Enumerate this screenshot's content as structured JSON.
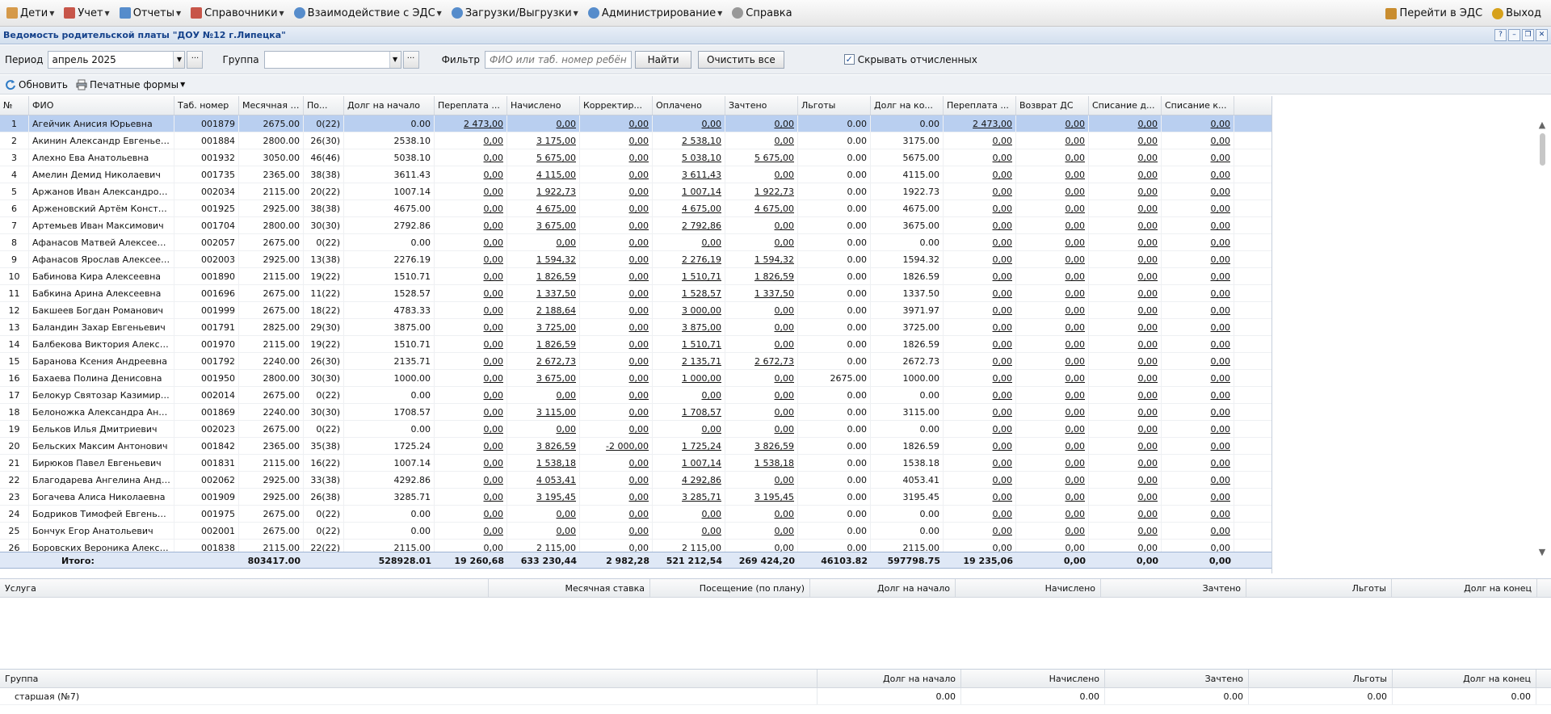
{
  "menu": {
    "items": [
      {
        "label": "Дети",
        "icon": "children-icon",
        "color": "#d08a2b"
      },
      {
        "label": "Учет",
        "icon": "accounting-icon",
        "color": "#c0392b"
      },
      {
        "label": "Отчеты",
        "icon": "reports-icon",
        "color": "#3b7ac4"
      },
      {
        "label": "Справочники",
        "icon": "directory-icon",
        "color": "#c0392b"
      },
      {
        "label": "Взаимодействие с ЭДС",
        "icon": "gears-icon",
        "color": "#3b7ac4"
      },
      {
        "label": "Загрузки/Выгрузки",
        "icon": "gears-icon",
        "color": "#3b7ac4"
      },
      {
        "label": "Администрирование",
        "icon": "gears-icon",
        "color": "#3b7ac4"
      },
      {
        "label": "Справка",
        "icon": "help-icon",
        "color": "#888888"
      }
    ],
    "go_eds": "Перейти в ЭДС",
    "exit": "Выход"
  },
  "window": {
    "title": "Ведомость родительской платы \"ДОУ №12 г.Липецка\"",
    "btn_help": "?",
    "btn_min": "–",
    "btn_max": "❐",
    "btn_close": "✕"
  },
  "filter": {
    "period_label": "Период",
    "period_value": "апрель 2025",
    "group_label": "Группа",
    "group_value": "",
    "filter_label": "Фильтр",
    "filter_placeholder": "ФИО или таб. номер ребёнка",
    "find": "Найти",
    "clear": "Очистить все",
    "hide_expelled": "Скрывать отчисленных",
    "hide_expelled_checked": true,
    "dots": "···"
  },
  "toolbar": {
    "refresh": "Обновить",
    "print": "Печатные формы"
  },
  "grid": {
    "columns": [
      "№",
      "ФИО",
      "Таб. номер",
      "Месячная ста...",
      "По...",
      "Долг на начало",
      "Переплата ...",
      "Начислено",
      "Корректир...",
      "Оплачено",
      "Зачтено",
      "Льготы",
      "Долг на ко...",
      "Переплата ...",
      "Возврат ДС",
      "Списание д...",
      "Списание к..."
    ],
    "rows": [
      [
        "1",
        "Агейчик Анисия Юрьевна",
        "001879",
        "2675.00",
        "0(22)",
        "0.00",
        "2 473,00",
        "0,00",
        "0,00",
        "0,00",
        "0,00",
        "0.00",
        "0.00",
        "2 473,00",
        "0,00",
        "0,00",
        "0,00"
      ],
      [
        "2",
        "Акинин Александр Евгеньевич",
        "001884",
        "2800.00",
        "26(30)",
        "2538.10",
        "0,00",
        "3 175,00",
        "0,00",
        "2 538,10",
        "0,00",
        "0.00",
        "3175.00",
        "0,00",
        "0,00",
        "0,00",
        "0,00"
      ],
      [
        "3",
        "Алехно Ева Анатольевна",
        "001932",
        "3050.00",
        "46(46)",
        "5038.10",
        "0,00",
        "5 675,00",
        "0,00",
        "5 038,10",
        "5 675,00",
        "0.00",
        "5675.00",
        "0,00",
        "0,00",
        "0,00",
        "0,00"
      ],
      [
        "4",
        "Амелин Демид Николаевич",
        "001735",
        "2365.00",
        "38(38)",
        "3611.43",
        "0,00",
        "4 115,00",
        "0,00",
        "3 611,43",
        "0,00",
        "0.00",
        "4115.00",
        "0,00",
        "0,00",
        "0,00",
        "0,00"
      ],
      [
        "5",
        "Аржанов Иван Александрович",
        "002034",
        "2115.00",
        "20(22)",
        "1007.14",
        "0,00",
        "1 922,73",
        "0,00",
        "1 007,14",
        "1 922,73",
        "0.00",
        "1922.73",
        "0,00",
        "0,00",
        "0,00",
        "0,00"
      ],
      [
        "6",
        "Арженовский Артём Константи...",
        "001925",
        "2925.00",
        "38(38)",
        "4675.00",
        "0,00",
        "4 675,00",
        "0,00",
        "4 675,00",
        "4 675,00",
        "0.00",
        "4675.00",
        "0,00",
        "0,00",
        "0,00",
        "0,00"
      ],
      [
        "7",
        "Артемьев Иван Максимович",
        "001704",
        "2800.00",
        "30(30)",
        "2792.86",
        "0,00",
        "3 675,00",
        "0,00",
        "2 792,86",
        "0,00",
        "0.00",
        "3675.00",
        "0,00",
        "0,00",
        "0,00",
        "0,00"
      ],
      [
        "8",
        "Афанасов Матвей Алексеевич",
        "002057",
        "2675.00",
        "0(22)",
        "0.00",
        "0,00",
        "0,00",
        "0,00",
        "0,00",
        "0,00",
        "0.00",
        "0.00",
        "0,00",
        "0,00",
        "0,00",
        "0,00"
      ],
      [
        "9",
        "Афанасов Ярослав Алексеевич",
        "002003",
        "2925.00",
        "13(38)",
        "2276.19",
        "0,00",
        "1 594,32",
        "0,00",
        "2 276,19",
        "1 594,32",
        "0.00",
        "1594.32",
        "0,00",
        "0,00",
        "0,00",
        "0,00"
      ],
      [
        "10",
        "Бабинова Кира Алексеевна",
        "001890",
        "2115.00",
        "19(22)",
        "1510.71",
        "0,00",
        "1 826,59",
        "0,00",
        "1 510,71",
        "1 826,59",
        "0.00",
        "1826.59",
        "0,00",
        "0,00",
        "0,00",
        "0,00"
      ],
      [
        "11",
        "Бабкина Арина Алексеевна",
        "001696",
        "2675.00",
        "11(22)",
        "1528.57",
        "0,00",
        "1 337,50",
        "0,00",
        "1 528,57",
        "1 337,50",
        "0.00",
        "1337.50",
        "0,00",
        "0,00",
        "0,00",
        "0,00"
      ],
      [
        "12",
        "Бакшеев Богдан Романович",
        "001999",
        "2675.00",
        "18(22)",
        "4783.33",
        "0,00",
        "2 188,64",
        "0,00",
        "3 000,00",
        "0,00",
        "0.00",
        "3971.97",
        "0,00",
        "0,00",
        "0,00",
        "0,00"
      ],
      [
        "13",
        "Баландин Захар Евгеньевич",
        "001791",
        "2825.00",
        "29(30)",
        "3875.00",
        "0,00",
        "3 725,00",
        "0,00",
        "3 875,00",
        "0,00",
        "0.00",
        "3725.00",
        "0,00",
        "0,00",
        "0,00",
        "0,00"
      ],
      [
        "14",
        "Балбекова Виктория Алексеевна",
        "001970",
        "2115.00",
        "19(22)",
        "1510.71",
        "0,00",
        "1 826,59",
        "0,00",
        "1 510,71",
        "0,00",
        "0.00",
        "1826.59",
        "0,00",
        "0,00",
        "0,00",
        "0,00"
      ],
      [
        "15",
        "Баранова Ксения Андреевна",
        "001792",
        "2240.00",
        "26(30)",
        "2135.71",
        "0,00",
        "2 672,73",
        "0,00",
        "2 135,71",
        "2 672,73",
        "0.00",
        "2672.73",
        "0,00",
        "0,00",
        "0,00",
        "0,00"
      ],
      [
        "16",
        "Бахаева Полина Денисовна",
        "001950",
        "2800.00",
        "30(30)",
        "1000.00",
        "0,00",
        "3 675,00",
        "0,00",
        "1 000,00",
        "0,00",
        "2675.00",
        "1000.00",
        "0,00",
        "0,00",
        "0,00",
        "0,00"
      ],
      [
        "17",
        "Белокур Святозар Казимирович",
        "002014",
        "2675.00",
        "0(22)",
        "0.00",
        "0,00",
        "0,00",
        "0,00",
        "0,00",
        "0,00",
        "0.00",
        "0.00",
        "0,00",
        "0,00",
        "0,00",
        "0,00"
      ],
      [
        "18",
        "Белоножка Александра Андрее...",
        "001869",
        "2240.00",
        "30(30)",
        "1708.57",
        "0,00",
        "3 115,00",
        "0,00",
        "1 708,57",
        "0,00",
        "0.00",
        "3115.00",
        "0,00",
        "0,00",
        "0,00",
        "0,00"
      ],
      [
        "19",
        "Бельков Илья Дмитриевич",
        "002023",
        "2675.00",
        "0(22)",
        "0.00",
        "0,00",
        "0,00",
        "0,00",
        "0,00",
        "0,00",
        "0.00",
        "0.00",
        "0,00",
        "0,00",
        "0,00",
        "0,00"
      ],
      [
        "20",
        "Бельских Максим Антонович",
        "001842",
        "2365.00",
        "35(38)",
        "1725.24",
        "0,00",
        "3 826,59",
        "-2 000,00",
        "1 725,24",
        "3 826,59",
        "0.00",
        "1826.59",
        "0,00",
        "0,00",
        "0,00",
        "0,00"
      ],
      [
        "21",
        "Бирюков Павел Евгеньевич",
        "001831",
        "2115.00",
        "16(22)",
        "1007.14",
        "0,00",
        "1 538,18",
        "0,00",
        "1 007,14",
        "1 538,18",
        "0.00",
        "1538.18",
        "0,00",
        "0,00",
        "0,00",
        "0,00"
      ],
      [
        "22",
        "Благодарева Ангелина Андреев...",
        "002062",
        "2925.00",
        "33(38)",
        "4292.86",
        "0,00",
        "4 053,41",
        "0,00",
        "4 292,86",
        "0,00",
        "0.00",
        "4053.41",
        "0,00",
        "0,00",
        "0,00",
        "0,00"
      ],
      [
        "23",
        "Богачева Алиса Николаевна",
        "001909",
        "2925.00",
        "26(38)",
        "3285.71",
        "0,00",
        "3 195,45",
        "0,00",
        "3 285,71",
        "3 195,45",
        "0.00",
        "3195.45",
        "0,00",
        "0,00",
        "0,00",
        "0,00"
      ],
      [
        "24",
        "Бодриков Тимофей Евгеньевич",
        "001975",
        "2675.00",
        "0(22)",
        "0.00",
        "0,00",
        "0,00",
        "0,00",
        "0,00",
        "0,00",
        "0.00",
        "0.00",
        "0,00",
        "0,00",
        "0,00",
        "0,00"
      ],
      [
        "25",
        "Бончук Егор Анатольевич",
        "002001",
        "2675.00",
        "0(22)",
        "0.00",
        "0,00",
        "0,00",
        "0,00",
        "0,00",
        "0,00",
        "0.00",
        "0.00",
        "0,00",
        "0,00",
        "0,00",
        "0,00"
      ],
      [
        "26",
        "Боровских Вероника Александр...",
        "001838",
        "2115.00",
        "22(22)",
        "2115.00",
        "0,00",
        "2 115,00",
        "0,00",
        "2 115,00",
        "0,00",
        "0.00",
        "2115.00",
        "0,00",
        "0,00",
        "0,00",
        "0,00"
      ]
    ],
    "total": [
      "",
      "Итого:",
      "",
      "803417.00",
      "",
      "528928.01",
      "19 260,68",
      "633 230,44",
      "2 982,28",
      "521 212,54",
      "269 424,20",
      "46103.82",
      "597798.75",
      "19 235,06",
      "0,00",
      "0,00",
      "0,00"
    ]
  },
  "services": {
    "columns": [
      "Услуга",
      "Месячная ставка",
      "Посещение (по плану)",
      "Долг на начало",
      "Начислено",
      "Зачтено",
      "Льготы",
      "Долг на конец"
    ]
  },
  "groups": {
    "columns": [
      "Группа",
      "Долг на начало",
      "Начислено",
      "Зачтено",
      "Льготы",
      "Долг на конец"
    ],
    "rows": [
      [
        "старшая (№7)",
        "0.00",
        "0.00",
        "0.00",
        "0.00",
        "0.00"
      ]
    ]
  }
}
